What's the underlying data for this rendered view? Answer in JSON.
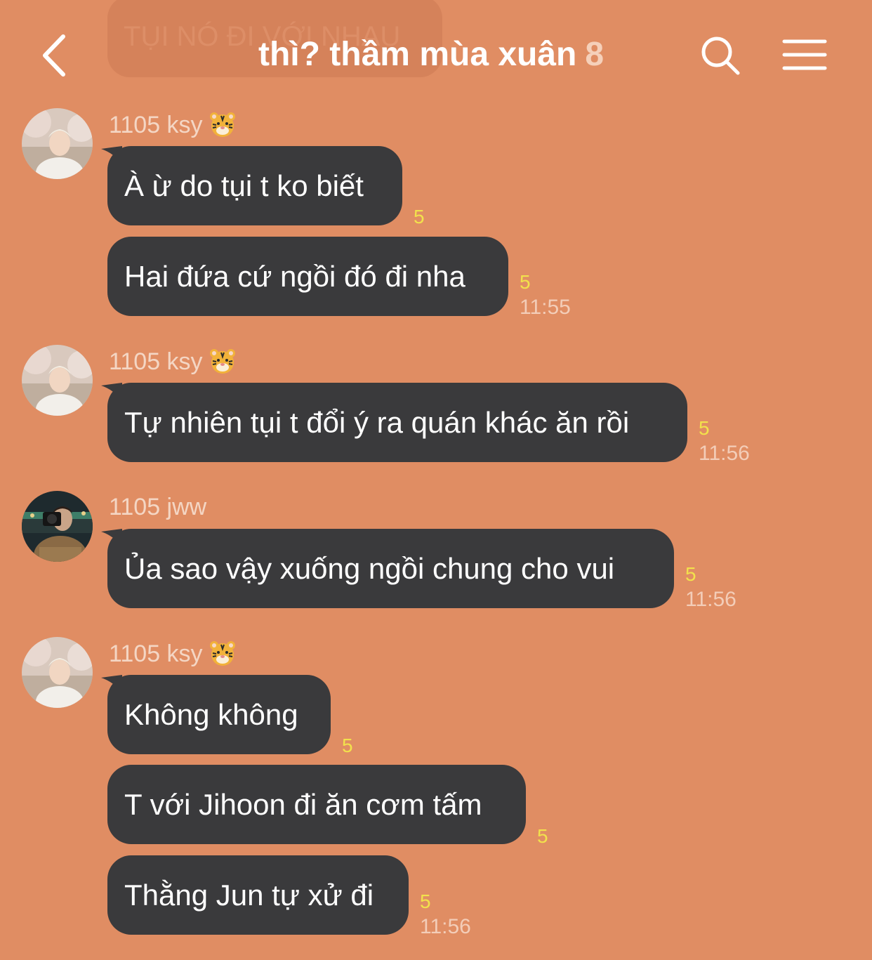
{
  "previous_message": {
    "text": "TỤI NÓ ĐI VỚI NHAU"
  },
  "header": {
    "title": "thì? thầm mùa xuân",
    "member_count": "8",
    "back_icon": "chevron-left-icon",
    "search_icon": "search-icon",
    "menu_icon": "menu-icon"
  },
  "colors": {
    "background": "#E08D63",
    "bubble": "#3A3A3C",
    "unread": "#F2E14C"
  },
  "groups": [
    {
      "sender": "1105 ksy",
      "sender_emoji": "tiger-face-icon",
      "messages": [
        {
          "text": "À ừ do tụi t ko biết",
          "unread": "5",
          "time": ""
        },
        {
          "text": "Hai đứa cứ ngồi đó đi nha",
          "unread": "5",
          "time": "11:55"
        }
      ]
    },
    {
      "sender": "1105 ksy",
      "sender_emoji": "tiger-face-icon",
      "messages": [
        {
          "text": "Tự nhiên tụi t đổi ý ra quán khác ăn rồi",
          "unread": "5",
          "time": "11:56"
        }
      ]
    },
    {
      "sender": "1105 jww",
      "sender_emoji": "",
      "messages": [
        {
          "text": "Ủa sao vậy xuống ngồi chung cho vui",
          "unread": "5",
          "time": "11:56"
        }
      ]
    },
    {
      "sender": "1105 ksy",
      "sender_emoji": "tiger-face-icon",
      "messages": [
        {
          "text": "Không không",
          "unread": "5",
          "time": ""
        },
        {
          "text": "T với Jihoon đi ăn cơm tấm",
          "unread": "5",
          "time": ""
        },
        {
          "text": "Thằng Jun tự xử đi",
          "unread": "5",
          "time": "11:56"
        }
      ]
    }
  ]
}
